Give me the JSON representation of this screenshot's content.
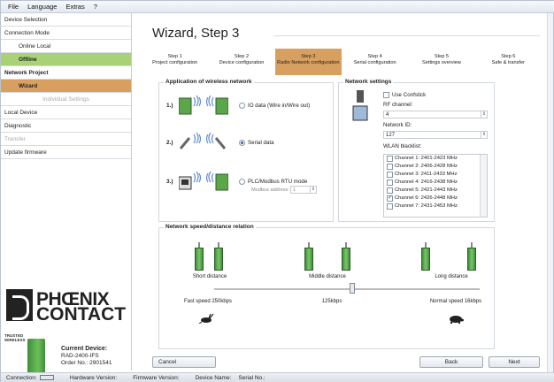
{
  "menu": [
    "File",
    "Language",
    "Extras",
    "?"
  ],
  "sidebar": {
    "items": [
      {
        "label": "Device Selection"
      },
      {
        "label": "Connection Mode"
      },
      {
        "label": "Online Local"
      },
      {
        "label": "Offline"
      },
      {
        "label": "Network Project"
      },
      {
        "label": "Wizard"
      },
      {
        "label": "Individual Settings"
      },
      {
        "label": "Local Device"
      },
      {
        "label": "Diagnostic"
      },
      {
        "label": "Transfer"
      },
      {
        "label": "Update firmware"
      }
    ],
    "logo_text": [
      "PHŒNIX",
      "CONTACT"
    ],
    "trusted_text": [
      "TRUSTED",
      "WIRELESS"
    ],
    "device": {
      "heading": "Current Device:",
      "model": "RAD-2400-IFS",
      "order": "Order No.: 2901541"
    }
  },
  "wizard": {
    "title": "Wizard, Step 3",
    "steps": [
      {
        "num": "Step 1",
        "label": "Project configuration"
      },
      {
        "num": "Step 2",
        "label": "Device configuration"
      },
      {
        "num": "Step 3",
        "label": "Radio Network configuration"
      },
      {
        "num": "Step 4",
        "label": "Serial configuration"
      },
      {
        "num": "Step 5",
        "label": "Settings overview"
      },
      {
        "num": "Step 6",
        "label": "Safe & transfer"
      }
    ]
  },
  "application": {
    "title": "Application of wireless network",
    "rows": [
      {
        "num": "1.)",
        "label": "IO data (Wire in/Wire out)",
        "selected": false
      },
      {
        "num": "2.)",
        "label": "Serial data",
        "selected": true
      },
      {
        "num": "3.)",
        "label": "PLC/Modbus RTU mode",
        "selected": false
      }
    ],
    "modbus_label": "Modbus address:",
    "modbus_value": "1"
  },
  "network": {
    "title": "Network settings",
    "use_confstick": "Use Confstick",
    "rf_label": "RF channel:",
    "rf_value": "4",
    "netid_label": "Network ID:",
    "netid_value": "127",
    "wlan_label": "WLAN blacklist:",
    "wlan": [
      {
        "label": "Channel 1: 2401-2423 MHz",
        "checked": false
      },
      {
        "label": "Channel 2: 2406-2428 MHz",
        "checked": false
      },
      {
        "label": "Channel 3: 2411-2433 MHz",
        "checked": false
      },
      {
        "label": "Channel 4: 2416-2438 MHz",
        "checked": false
      },
      {
        "label": "Channel 5: 2421-2443 MHz",
        "checked": false
      },
      {
        "label": "Channel 6: 2426-2448 MHz",
        "checked": true
      },
      {
        "label": "Channel 7: 2431-2453 MHz",
        "checked": false
      }
    ]
  },
  "speed": {
    "title": "Network speed/distance relation",
    "distances": [
      "Short distance",
      "Middle distance",
      "Long distance"
    ],
    "speeds": [
      "Fast speed 250kbps",
      "125kbps",
      "Normal speed 16kbps"
    ],
    "slider_position": 0.5
  },
  "buttons": {
    "cancel": "Cancel",
    "back": "Back",
    "next": "Next"
  },
  "status": {
    "connection": "Connection:",
    "hw": "Hardware Version:",
    "fw": "Firmware Version:",
    "device_name": "Device Name:",
    "serial": "Serial No.:"
  },
  "colors": {
    "accent_green": "#a9d175",
    "accent_orange": "#d8a060"
  }
}
